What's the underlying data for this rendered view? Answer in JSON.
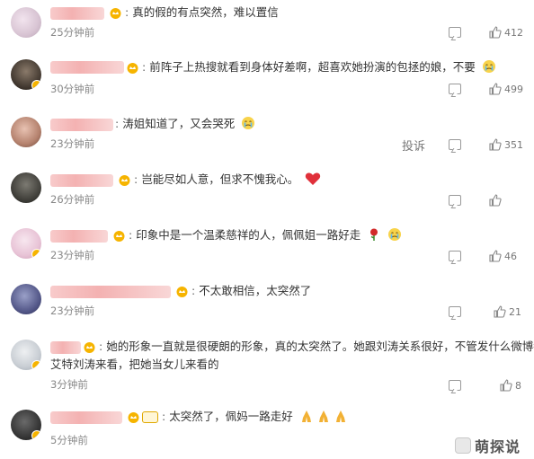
{
  "comments": [
    {
      "text": "真的假的有点突然，难以置信",
      "time": "25分钟前",
      "likes": "412",
      "emoji": ""
    },
    {
      "text": "前阵子上热搜就看到身体好差啊，超喜欢她扮演的包拯的娘，不要",
      "time": "30分钟前",
      "likes": "499",
      "emoji": "cry-face-icon"
    },
    {
      "text": "涛姐知道了，又会哭死",
      "time": "23分钟前",
      "likes": "351",
      "emoji": "cry-face-icon",
      "report": "投诉"
    },
    {
      "text": "岂能尽如人意，但求不愧我心。",
      "time": "26分钟前",
      "likes": "",
      "emoji": "heart-icon"
    },
    {
      "text": "印象中是一个温柔慈祥的人，佩佩姐一路好走",
      "time": "23分钟前",
      "likes": "46",
      "emoji": "rose-and-cry-icon"
    },
    {
      "text": "不太敢相信，太突然了",
      "time": "23分钟前",
      "likes": "21",
      "emoji": ""
    },
    {
      "text": "她的形象一直就是很硬朗的形象，真的太突然了。她跟刘涛关系很好，不管发什么微博都会",
      "text2": "艾特刘涛来看，把她当女儿来看的",
      "time": "3分钟前",
      "likes": "8",
      "emoji": ""
    },
    {
      "text": "太突然了，佩妈一路走好",
      "time": "5分钟前",
      "likes": "",
      "emoji": "pray-hands-icon"
    }
  ],
  "watermark": "萌探说",
  "colors": {
    "crown": "#f6b400",
    "heart": "#e0303a",
    "badge": "#f6b400"
  }
}
